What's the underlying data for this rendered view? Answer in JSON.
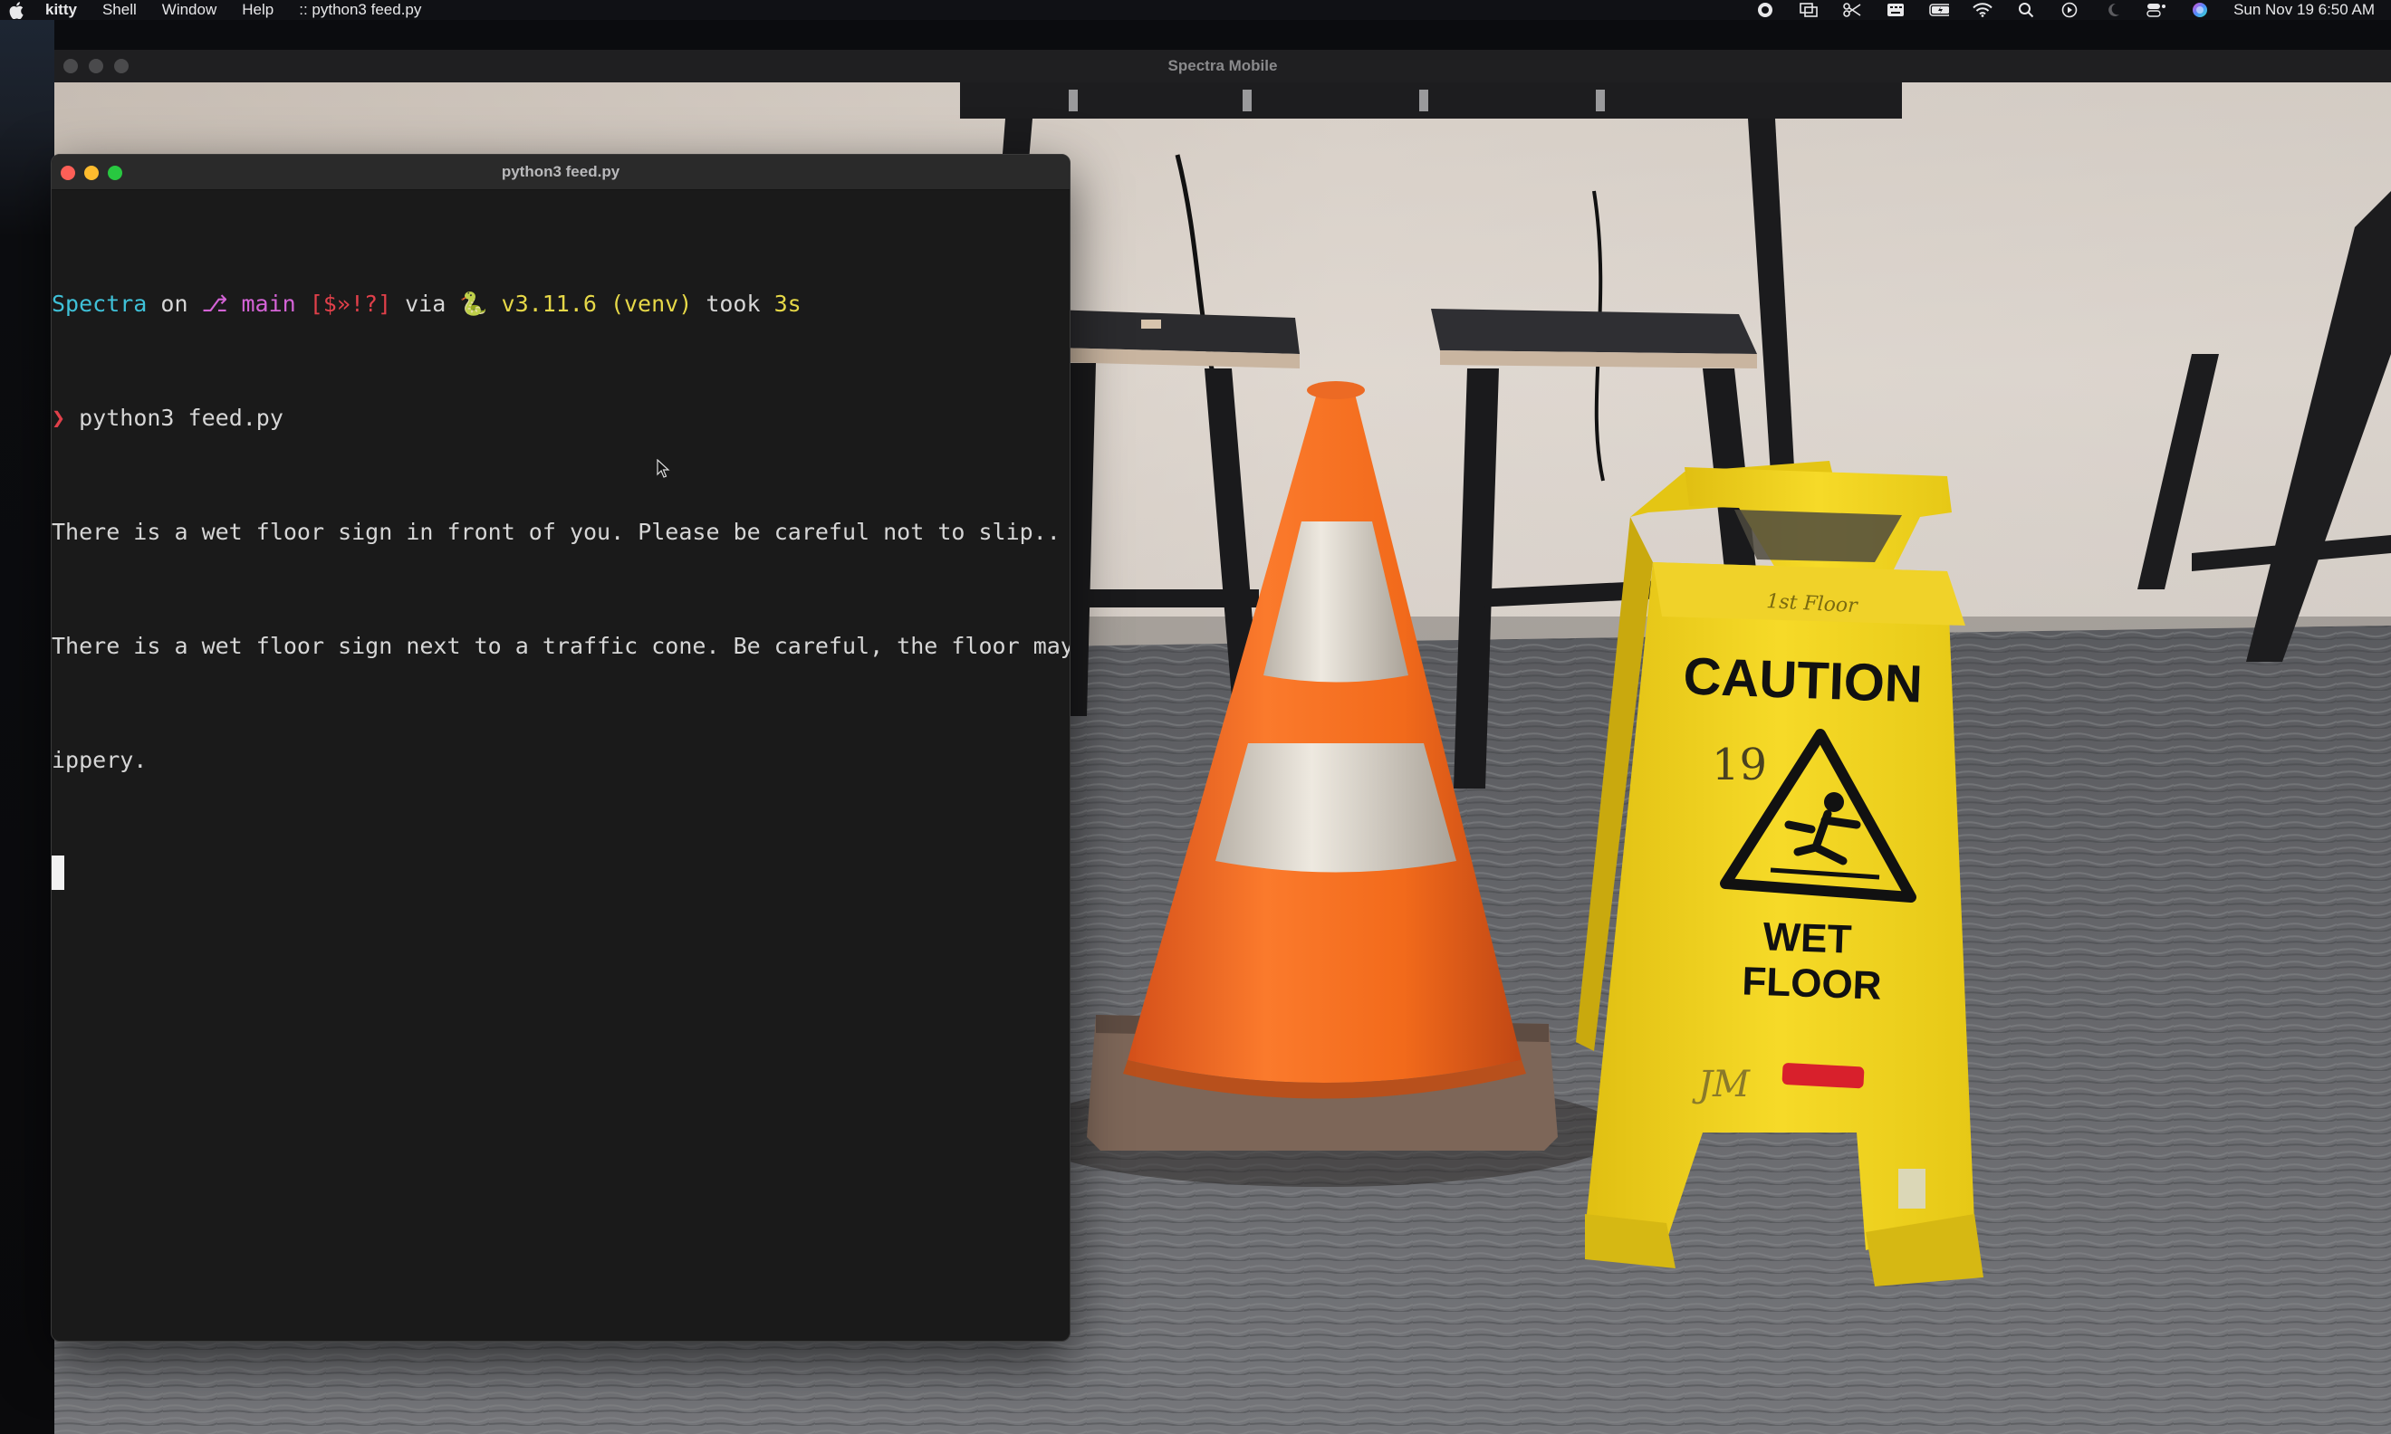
{
  "menubar": {
    "app": "kitty",
    "items": [
      "Shell",
      "Window",
      "Help"
    ],
    "active_title": ":: python3 feed.py",
    "clock": "Sun Nov 19  6:50 AM",
    "icons": [
      "record-icon",
      "screen-mirror-icon",
      "scissors-icon",
      "keyboard-icon",
      "battery-icon",
      "wifi-icon",
      "search-icon",
      "play-icon",
      "moon-icon",
      "control-center-icon",
      "siri-icon"
    ]
  },
  "spectra_window": {
    "title": "Spectra Mobile"
  },
  "camera_sign": {
    "top_text": "1st Floor",
    "caution": "CAUTION",
    "number": "19",
    "wet": "WET",
    "floor": "FLOOR",
    "initials": "JM"
  },
  "terminal": {
    "title": "python3 feed.py",
    "prompt": {
      "dir": "Spectra",
      "on": "on",
      "branch_icon": "⎇",
      "branch": "main",
      "status": "[$»!?]",
      "via": "via",
      "python_icon": "🐍",
      "version": "v3.11.6 (venv)",
      "took": "took",
      "duration": "3s"
    },
    "command_symbol": "❯",
    "command": "python3 feed.py",
    "output": [
      "There is a wet floor sign in front of you. Please be careful not to slip..",
      "There is a wet floor sign next to a traffic cone. Be careful, the floor may be sl",
      "ippery."
    ]
  },
  "colors": {
    "prompt_dir": "#3fc1d8",
    "branch": "#d463d6",
    "status": "#e0404a",
    "version": "#e6d848",
    "sign_yellow": "#f3d51c",
    "cone_orange": "#f26a1b"
  }
}
